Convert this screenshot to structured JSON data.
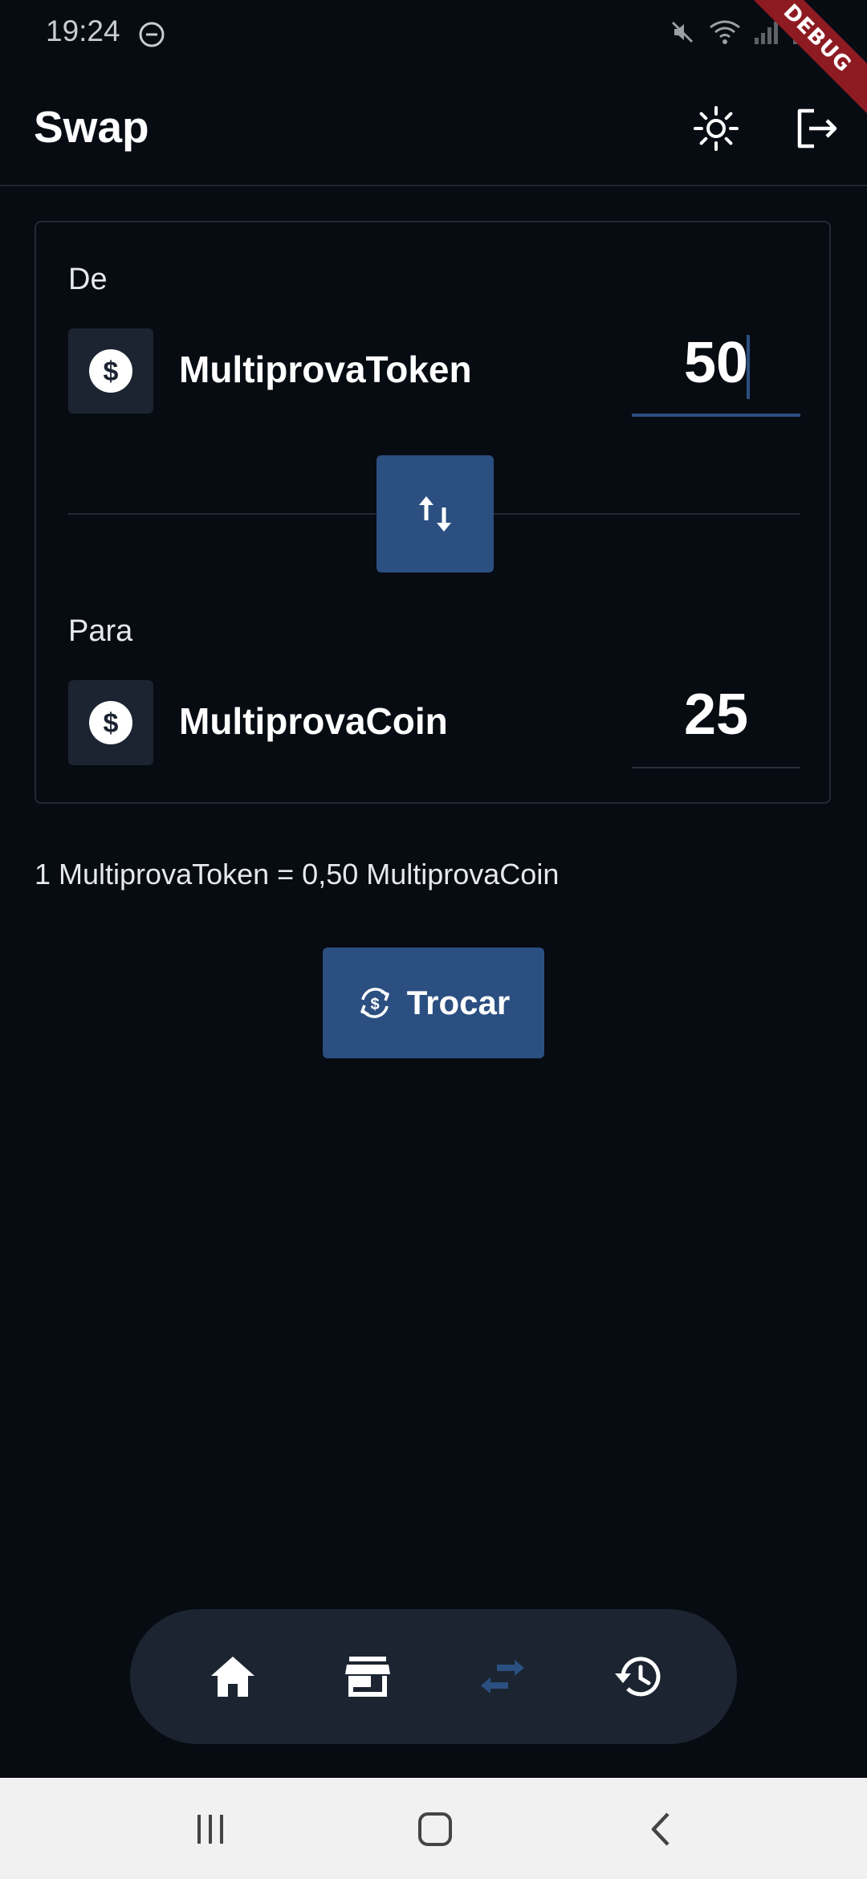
{
  "status_bar": {
    "time": "19:24",
    "debug_label": "DEBUG"
  },
  "app_bar": {
    "title": "Swap",
    "icons": [
      "sun-icon",
      "logout-icon"
    ]
  },
  "swap": {
    "from": {
      "label": "De",
      "token": "MultiprovaToken",
      "amount": "50",
      "icon": "dollar-coin-icon"
    },
    "to": {
      "label": "Para",
      "token": "MultiprovaCoin",
      "amount": "25",
      "icon": "dollar-coin-icon"
    },
    "switch_icon": "swap-vertical-icon",
    "rate": "1 MultiprovaToken = 0,50 MultiprovaCoin",
    "submit_label": "Trocar",
    "submit_icon": "currency-exchange-icon"
  },
  "bottom_nav": {
    "items": [
      {
        "name": "home",
        "icon": "home-icon",
        "active": false
      },
      {
        "name": "store",
        "icon": "store-icon",
        "active": false
      },
      {
        "name": "swap",
        "icon": "swap-horizontal-icon",
        "active": true
      },
      {
        "name": "history",
        "icon": "history-icon",
        "active": false
      }
    ]
  },
  "colors": {
    "background": "#070b12",
    "accent": "#2b4f80",
    "surface": "#1b2430",
    "border": "#222a35",
    "debug_ribbon": "#8e1b22"
  }
}
